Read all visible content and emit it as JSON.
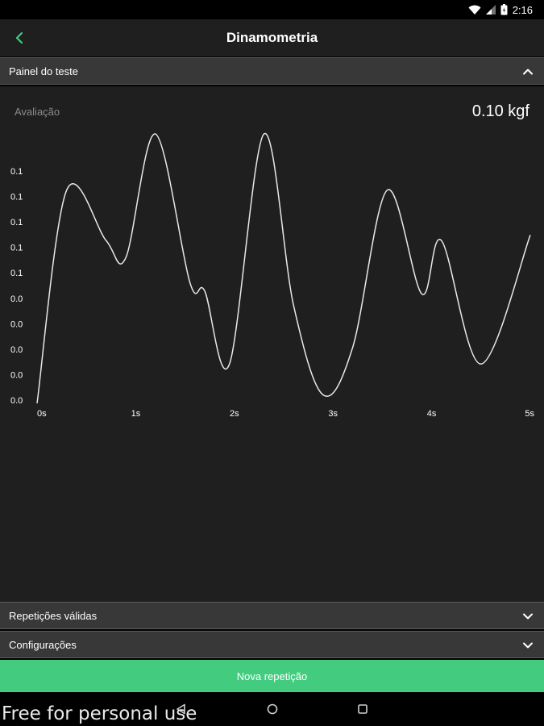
{
  "status_bar": {
    "time": "2:16"
  },
  "app_bar": {
    "title": "Dinamometria"
  },
  "sections": {
    "panel": {
      "label": "Painel do teste"
    },
    "repeticoes": {
      "label": "Repetições válidas"
    },
    "configuracoes": {
      "label": "Configurações"
    }
  },
  "panel": {
    "evaluation_label": "Avaliação",
    "evaluation_value": "0.10 kgf"
  },
  "chart_data": {
    "type": "line",
    "x": [
      0,
      0.3,
      0.7,
      0.9,
      1.2,
      1.55,
      1.7,
      1.95,
      2.3,
      2.6,
      2.9,
      3.2,
      3.55,
      3.9,
      4.1,
      4.5,
      5.0
    ],
    "y": [
      0.0,
      0.076,
      0.058,
      0.052,
      0.096,
      0.043,
      0.04,
      0.014,
      0.096,
      0.035,
      0.003,
      0.02,
      0.076,
      0.039,
      0.058,
      0.014,
      0.06
    ],
    "xticks": [
      "0s",
      "1s",
      "2s",
      "3s",
      "4s",
      "5s"
    ],
    "yticks": [
      "0.1",
      "0.1",
      "0.1",
      "0.1",
      "0.1",
      "0.0",
      "0.0",
      "0.0",
      "0.0",
      "0.0"
    ],
    "xlim": [
      0,
      5
    ],
    "ylim": [
      0,
      0.09
    ],
    "line_color": "#e8e8e8",
    "grid": false
  },
  "cta": {
    "label": "Nova repetição"
  },
  "nav_bar": {
    "watermark": "Free for personal use"
  },
  "colors": {
    "accent": "#43cb7f",
    "background": "#1f1f1f",
    "header": "#383838"
  },
  "icons": {
    "back": "chevron-left-icon",
    "panel_toggle": "chevron-up-icon",
    "section_toggle": "chevron-down-icon",
    "wifi": "wifi-icon",
    "signal": "signal-icon",
    "battery": "battery-icon",
    "nav_back": "nav-back-icon",
    "nav_home": "nav-home-icon",
    "nav_recents": "nav-recents-icon"
  }
}
